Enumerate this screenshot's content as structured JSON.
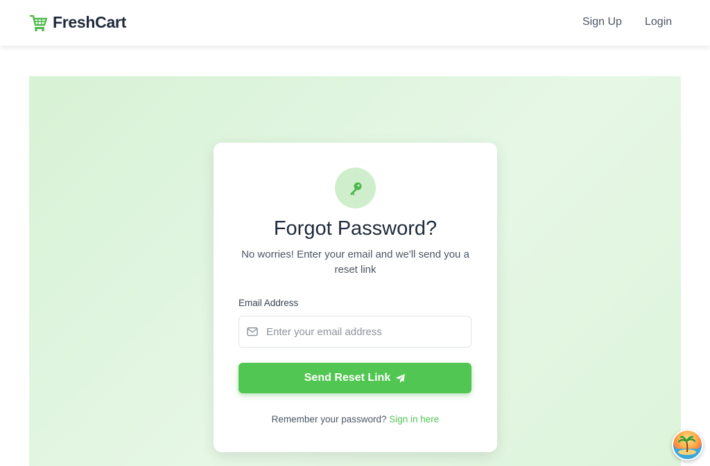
{
  "header": {
    "brand_name": "FreshCart",
    "brand_icon": "cart-icon",
    "nav": {
      "signup_label": "Sign Up",
      "login_label": "Login"
    }
  },
  "card": {
    "badge_icon": "key-icon",
    "title": "Forgot Password?",
    "subtitle": "No worries! Enter your email and we'll send you a reset link",
    "email_label": "Email Address",
    "email_icon": "envelope-icon",
    "email_placeholder": "Enter your email address",
    "email_value": "",
    "submit_label": "Send Reset Link",
    "submit_icon": "paper-plane-icon",
    "footer_text": "Remember your password?",
    "footer_link": "Sign in here"
  },
  "floating_button": {
    "icon": "beach-avatar-icon"
  },
  "colors": {
    "accent": "#52c652",
    "hero_bg": "#d7f2d5",
    "badge_bg": "#cfeecc",
    "text_dark": "#1e293b",
    "text_muted": "#4b5563"
  }
}
